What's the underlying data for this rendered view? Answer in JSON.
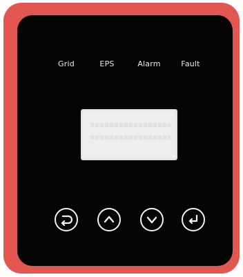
{
  "indicators": [
    {
      "label": "Grid"
    },
    {
      "label": "EPS"
    },
    {
      "label": "Alarm"
    },
    {
      "label": "Fault"
    }
  ],
  "display": {
    "state": "blank"
  },
  "buttons": [
    {
      "icon": "back-return-icon"
    },
    {
      "icon": "up-arrow-icon"
    },
    {
      "icon": "down-arrow-icon"
    },
    {
      "icon": "enter-icon"
    }
  ],
  "colors": {
    "frame": "#e2574f",
    "panel": "#050505",
    "lcd": "#eeeeee",
    "text": "#e9e9e9"
  }
}
